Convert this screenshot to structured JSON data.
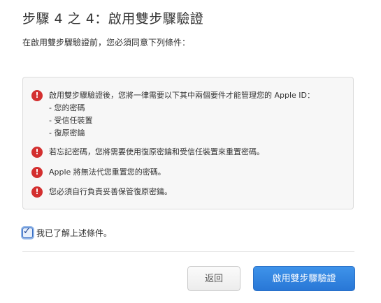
{
  "header": {
    "title": "步驟 4 之 4：啟用雙步驟驗證"
  },
  "intro": {
    "text": "在啟用雙步驟驗證前，您必須同意下列條件："
  },
  "warnings": {
    "icon": "exclamation-icon",
    "icon_color": "#d32f2f",
    "first": {
      "text": "啟用雙步驟驗證後，您將一律需要以下其中兩個要件才能管理您的 Apple ID：",
      "list": [
        "- 您的密碼",
        "- 受信任裝置",
        "- 復原密鑰"
      ]
    },
    "second": "若忘記密碼，您將需要使用復原密鑰和受信任裝置來重置密碼。",
    "third": "Apple 將無法代您重置您的密碼。",
    "fourth": "您必須自行負責妥善保管復原密鑰。"
  },
  "agreement": {
    "checked": true,
    "label": "我已了解上述條件。"
  },
  "buttons": {
    "back_label": "返回",
    "enable_label": "啟用雙步驟驗證",
    "accent": "#2f80dd"
  }
}
